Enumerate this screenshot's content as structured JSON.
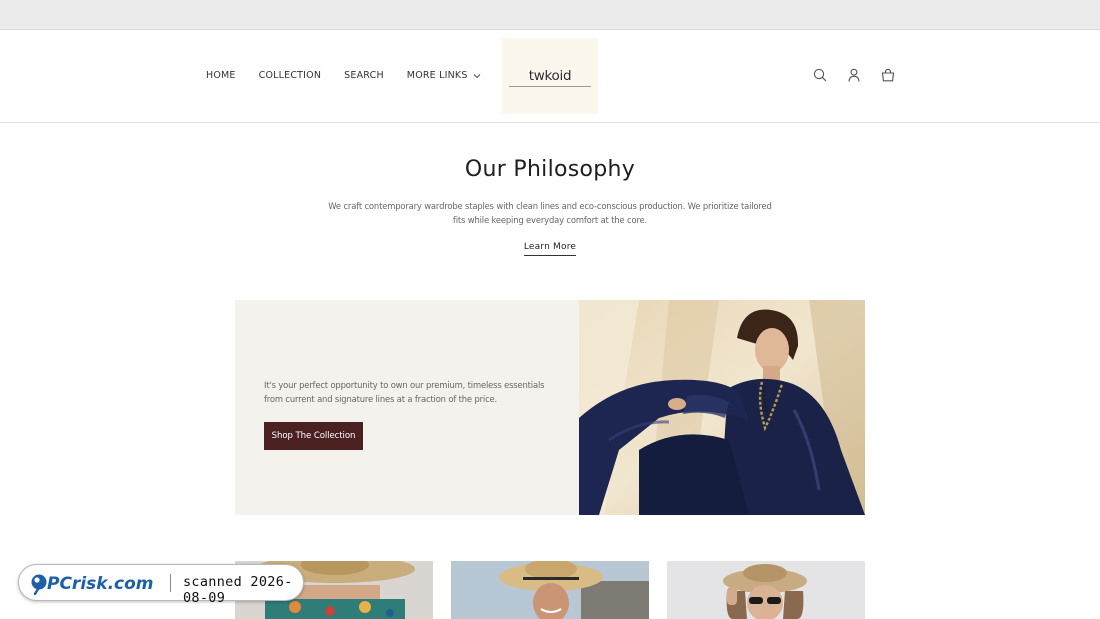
{
  "nav": {
    "items": [
      {
        "label": "HOME"
      },
      {
        "label": "COLLECTION"
      },
      {
        "label": "SEARCH"
      },
      {
        "label": "MORE LINKS",
        "has_dropdown": true
      }
    ]
  },
  "brand": {
    "name": "twkoid"
  },
  "header_icons": [
    "search-icon",
    "account-icon",
    "cart-icon"
  ],
  "philosophy": {
    "title": "Our Philosophy",
    "body": "We craft contemporary wardrobe staples with clean lines and eco-conscious production. We prioritize tailored fits while keeping everyday comfort at the core.",
    "link_label": "Learn More"
  },
  "promo": {
    "text": "It's your perfect opportunity to own our premium, timeless essentials from current and signature lines at a fraction of the price.",
    "button_label": "Shop The Collection",
    "button_color": "#4a2020",
    "background": "#f4f2ec"
  },
  "products": [
    {
      "image": "woman-straw-hat-floral-dress"
    },
    {
      "image": "woman-straw-hat-smiling"
    },
    {
      "image": "woman-straw-hat-sunglasses"
    }
  ],
  "watermark": {
    "logo_text": "PCrisk.com",
    "text": "scanned 2026-08-09"
  },
  "colors": {
    "top_strip": "#ebebeb",
    "logo_bg": "#fbf7ec",
    "accent": "#4a2020"
  }
}
